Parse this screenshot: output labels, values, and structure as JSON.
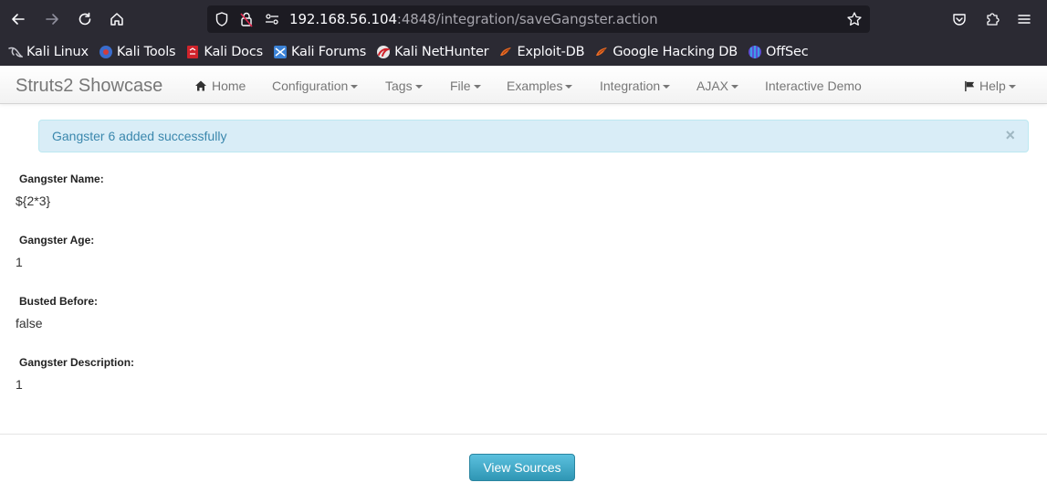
{
  "browser": {
    "url_host": "192.168.56.104",
    "url_rest": ":4848/integration/saveGangster.action",
    "bookmarks": [
      {
        "label": "Kali Linux",
        "icon": "kali-dragon-icon"
      },
      {
        "label": "Kali Tools",
        "icon": "kali-tools-icon"
      },
      {
        "label": "Kali Docs",
        "icon": "kali-docs-icon"
      },
      {
        "label": "Kali Forums",
        "icon": "kali-forums-icon"
      },
      {
        "label": "Kali NetHunter",
        "icon": "nethunter-icon"
      },
      {
        "label": "Exploit-DB",
        "icon": "exploit-db-icon"
      },
      {
        "label": "Google Hacking DB",
        "icon": "ghdb-icon"
      },
      {
        "label": "OffSec",
        "icon": "offsec-icon"
      }
    ]
  },
  "navbar": {
    "brand": "Struts2 Showcase",
    "items": [
      {
        "label": "Home"
      },
      {
        "label": "Configuration"
      },
      {
        "label": "Tags"
      },
      {
        "label": "File"
      },
      {
        "label": "Examples"
      },
      {
        "label": "Integration"
      },
      {
        "label": "AJAX"
      },
      {
        "label": "Interactive Demo"
      },
      {
        "label": "Help"
      }
    ]
  },
  "alert": {
    "message": "Gangster 6 added successfully",
    "close": "×"
  },
  "fields": [
    {
      "label": "Gangster Name:",
      "value": "${2*3}"
    },
    {
      "label": "Gangster Age:",
      "value": "1"
    },
    {
      "label": "Busted Before:",
      "value": "false"
    },
    {
      "label": "Gangster Description:",
      "value": "1"
    }
  ],
  "footer": {
    "view_sources": "View Sources"
  }
}
